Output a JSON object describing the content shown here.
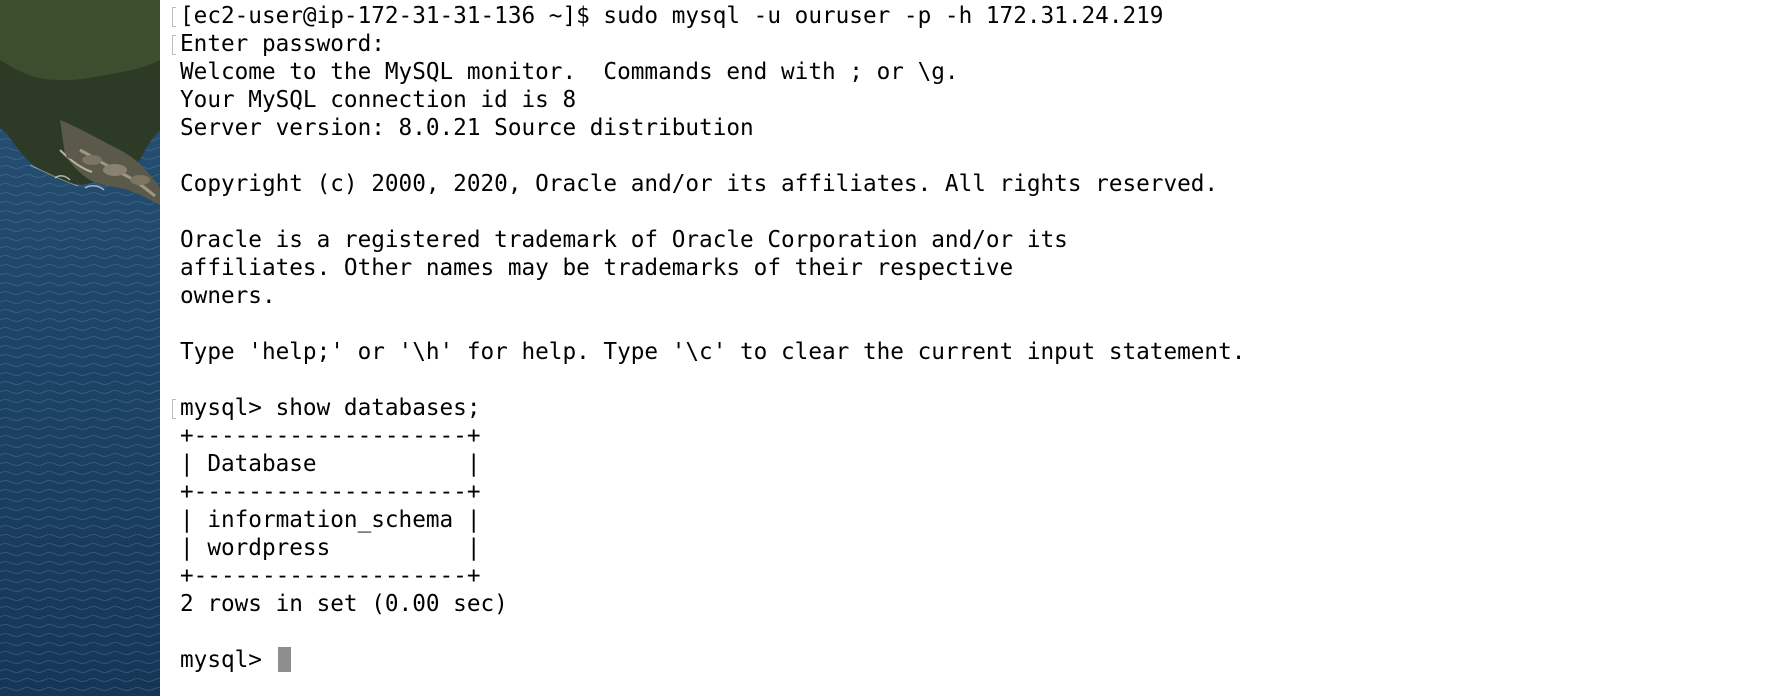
{
  "terminal": {
    "lines": [
      {
        "text": "[ec2-user@ip-172-31-31-136 ~]$ sudo mysql -u ouruser -p -h 172.31.24.219",
        "marked": true
      },
      {
        "text": "Enter password:",
        "marked": true
      },
      {
        "text": "Welcome to the MySQL monitor.  Commands end with ; or \\g.",
        "marked": false
      },
      {
        "text": "Your MySQL connection id is 8",
        "marked": false
      },
      {
        "text": "Server version: 8.0.21 Source distribution",
        "marked": false
      },
      {
        "text": "",
        "marked": false
      },
      {
        "text": "Copyright (c) 2000, 2020, Oracle and/or its affiliates. All rights reserved.",
        "marked": false
      },
      {
        "text": "",
        "marked": false
      },
      {
        "text": "Oracle is a registered trademark of Oracle Corporation and/or its",
        "marked": false
      },
      {
        "text": "affiliates. Other names may be trademarks of their respective",
        "marked": false
      },
      {
        "text": "owners.",
        "marked": false
      },
      {
        "text": "",
        "marked": false
      },
      {
        "text": "Type 'help;' or '\\h' for help. Type '\\c' to clear the current input statement.",
        "marked": false
      },
      {
        "text": "",
        "marked": false
      },
      {
        "text": "mysql> show databases;",
        "marked": true
      },
      {
        "text": "+--------------------+",
        "marked": false
      },
      {
        "text": "| Database           |",
        "marked": false
      },
      {
        "text": "+--------------------+",
        "marked": false
      },
      {
        "text": "| information_schema |",
        "marked": false
      },
      {
        "text": "| wordpress          |",
        "marked": false
      },
      {
        "text": "+--------------------+",
        "marked": false
      },
      {
        "text": "2 rows in set (0.00 sec)",
        "marked": false
      },
      {
        "text": "",
        "marked": false
      }
    ],
    "prompt": "mysql> "
  }
}
